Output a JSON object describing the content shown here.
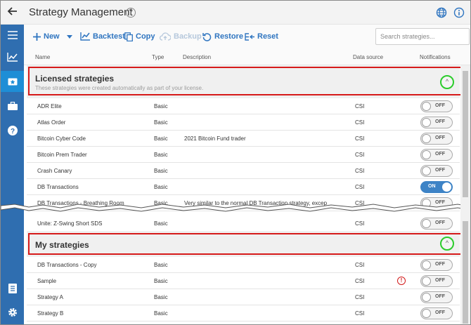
{
  "window": {
    "title": "Strategy Management",
    "help_glyph": "?"
  },
  "sidebar": {
    "items": [
      {
        "icon": "menu-icon"
      },
      {
        "icon": "chart-icon"
      },
      {
        "icon": "strategy-icon",
        "active": true
      },
      {
        "icon": "briefcase-icon"
      },
      {
        "icon": "help-circle-icon"
      },
      {
        "icon": "document-icon"
      },
      {
        "icon": "gear-icon"
      }
    ]
  },
  "toolbar": {
    "new_label": "New",
    "backtest_label": "Backtest",
    "copy_label": "Copy",
    "backup_label": "Backup",
    "restore_label": "Restore",
    "reset_label": "Reset",
    "search_placeholder": "Search strategies..."
  },
  "columns": {
    "name": "Name",
    "type": "Type",
    "description": "Description",
    "data_source": "Data source",
    "notifications": "Notifications"
  },
  "groups": {
    "licensed": {
      "title": "Licensed strategies",
      "subtitle": "These strategies were created automatically as part of your license.",
      "rows": [
        {
          "name": "ADR Elite",
          "type": "Basic",
          "description": "",
          "source": "CSI",
          "toggle": "OFF"
        },
        {
          "name": "Atlas Order",
          "type": "Basic",
          "description": "",
          "source": "CSI",
          "toggle": "OFF"
        },
        {
          "name": "Bitcoin Cyber Code",
          "type": "Basic",
          "description": "2021 Bitcoin Fund trader",
          "source": "CSI",
          "toggle": "OFF"
        },
        {
          "name": "Bitcoin Prem Trader",
          "type": "Basic",
          "description": "",
          "source": "CSI",
          "toggle": "OFF"
        },
        {
          "name": "Crash Canary",
          "type": "Basic",
          "description": "",
          "source": "CSI",
          "toggle": "OFF"
        },
        {
          "name": "DB Transactions",
          "type": "Basic",
          "description": "",
          "source": "CSI",
          "toggle": "ON"
        },
        {
          "name": "DB Transactions - Breathing Room",
          "type": "Basic",
          "description": "Very similar to the normal DB Transaction strategy, excep",
          "source": "CSI",
          "toggle": "OFF"
        },
        {
          "name": "Unite: Z-Swing Short SDS",
          "type": "Basic",
          "description": "",
          "source": "CSI",
          "toggle": "OFF"
        }
      ]
    },
    "mine": {
      "title": "My strategies",
      "rows": [
        {
          "name": "DB Transactions - Copy",
          "type": "Basic",
          "description": "",
          "source": "CSI",
          "toggle": "OFF"
        },
        {
          "name": "Sample",
          "type": "Basic",
          "description": "",
          "source": "CSI",
          "toggle": "OFF",
          "warning": "!"
        },
        {
          "name": "Strategy A",
          "type": "Basic",
          "description": "",
          "source": "CSI",
          "toggle": "OFF"
        },
        {
          "name": "Strategy B",
          "type": "Basic",
          "description": "",
          "source": "CSI",
          "toggle": "OFF"
        }
      ]
    }
  },
  "colors": {
    "accent": "#2f75c0",
    "sidebar": "#2f6eb0",
    "highlight_box": "#d61a1a",
    "highlight_circle": "#2ccc2c"
  }
}
